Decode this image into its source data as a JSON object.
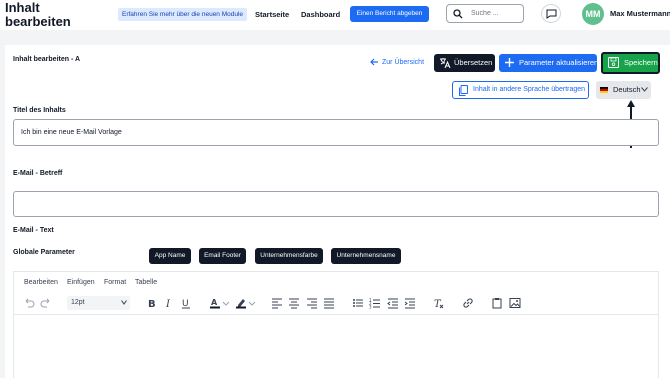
{
  "header": {
    "title": "Inhalt bearbeiten",
    "info_badge": "Erfahren Sie mehr über die neuen Module",
    "nav": [
      "Startseite",
      "Dashboard"
    ],
    "report_button": "Einen Bericht abgeben",
    "search_placeholder": "Suche ...",
    "user": {
      "initials": "MM",
      "name": "Max Mustermann"
    }
  },
  "card": {
    "title": "Inhalt bearbeiten - A",
    "back_link": "Zur Übersicht",
    "translate_button": "Übersetzen",
    "params_button": "Parameter aktualisieren",
    "save_button": "Speichern",
    "transfer_button": "Inhalt in andere Sprache übertragen",
    "language": "Deutsch"
  },
  "form": {
    "content_title_label": "Titel des Inhalts",
    "content_title_value": "Ich bin eine neue E-Mail Vorlage",
    "subject_label": "E-Mail - Betreff",
    "subject_value": "",
    "text_label": "E-Mail - Text",
    "global_params_label": "Globale Parameter",
    "global_params": [
      "App Name",
      "Email Footer",
      "Unternehmensfarbe",
      "Unternehmensname"
    ]
  },
  "editor": {
    "menu": [
      "Bearbeiten",
      "Einfügen",
      "Format",
      "Tabelle"
    ],
    "font_size": "12pt"
  },
  "colors": {
    "primary": "#1d6bf3",
    "save": "#16a34a",
    "dark": "#111827",
    "avatar": "#5fbf8e"
  }
}
